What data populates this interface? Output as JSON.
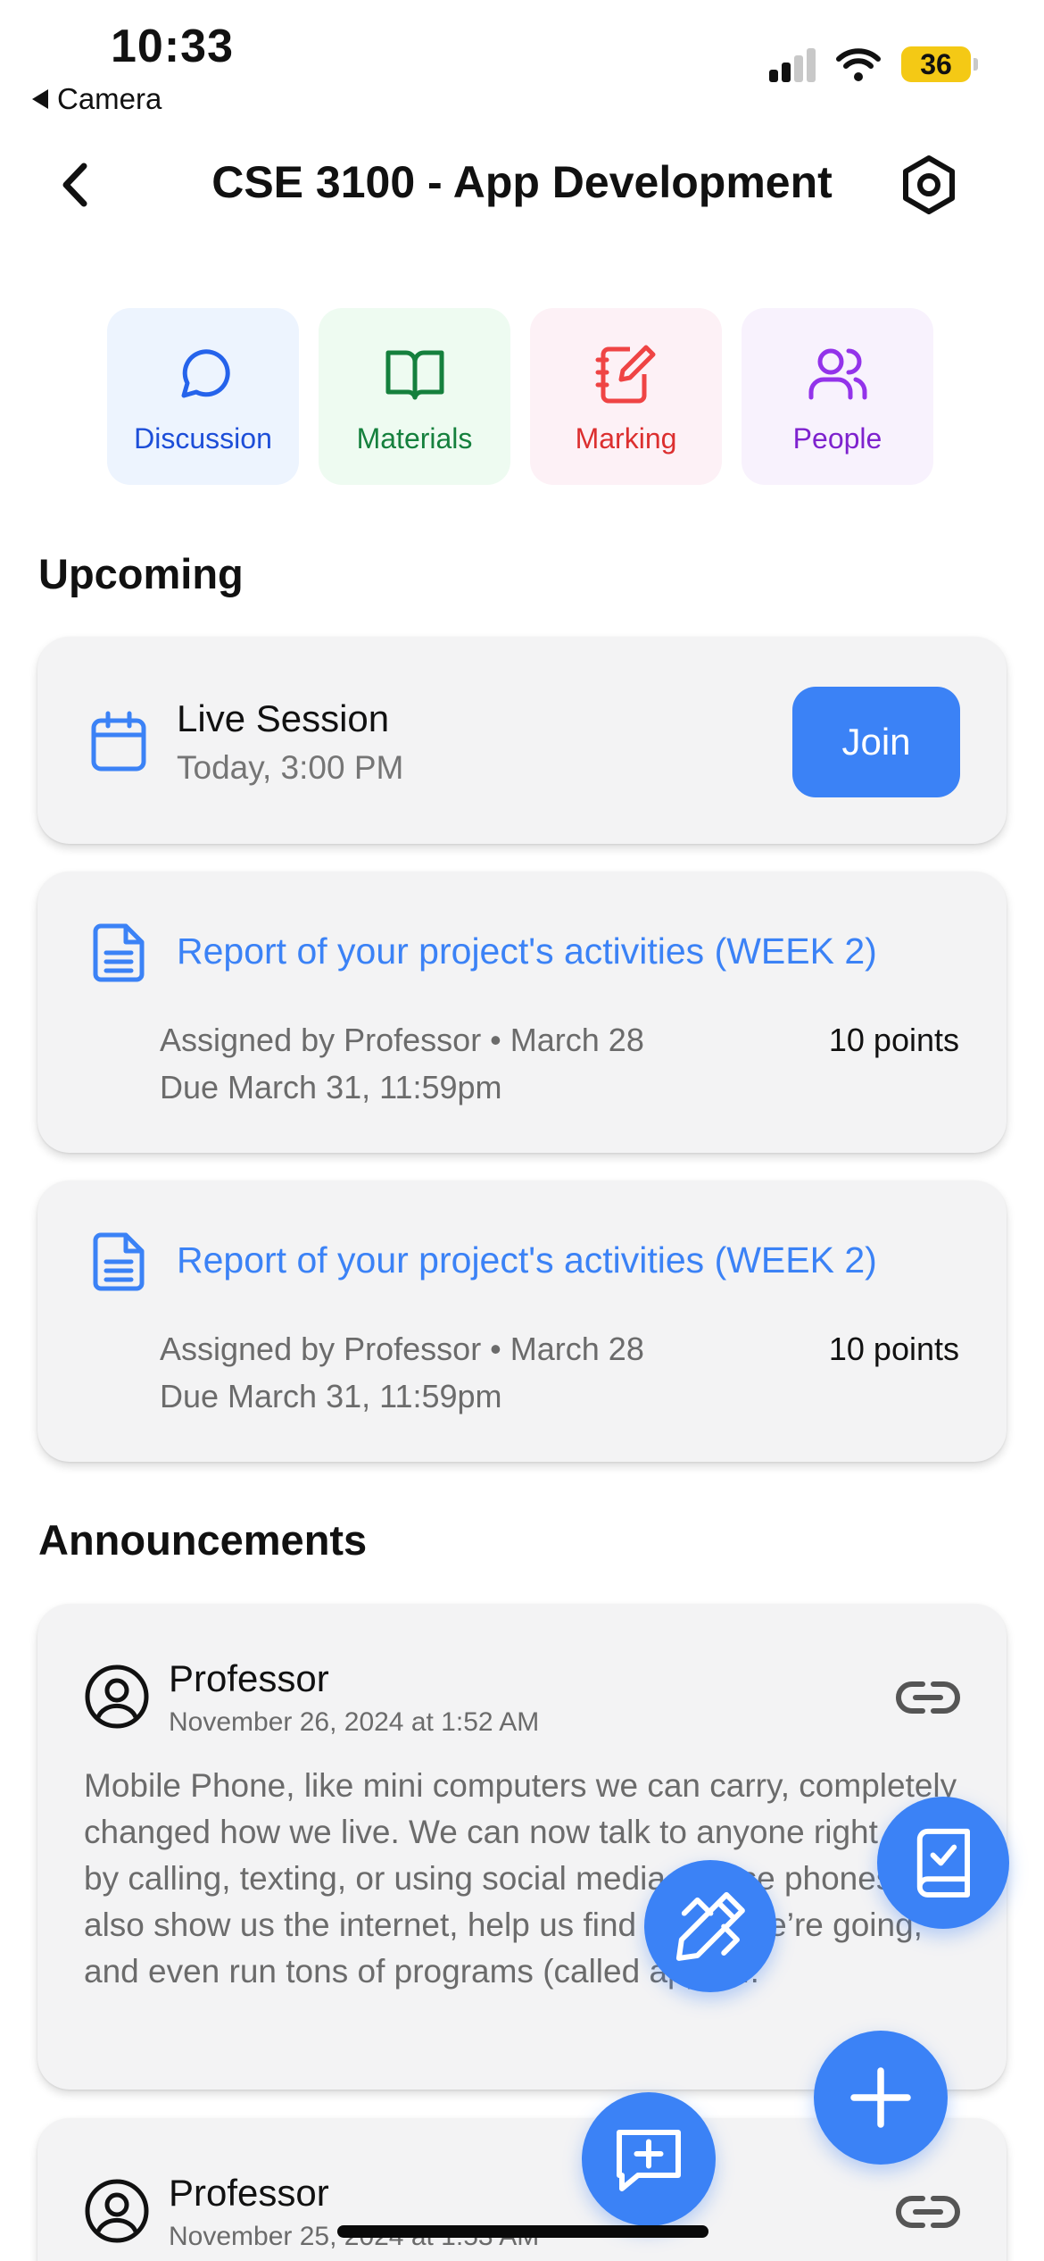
{
  "status_bar": {
    "time": "10:33",
    "back_app": "Camera",
    "battery": "36",
    "signal_icon": "cellular-signal-icon",
    "wifi_icon": "wifi-icon"
  },
  "header": {
    "title": "CSE 3100 - App Development",
    "back_icon": "chevron-left-icon",
    "settings_icon": "settings-hexagon-icon"
  },
  "tiles": [
    {
      "label": "Discussion",
      "icon": "chat-bubble-icon",
      "color": "#1d4ed8",
      "bg": "#edf4fe"
    },
    {
      "label": "Materials",
      "icon": "open-book-icon",
      "color": "#15803d",
      "bg": "#eefbf1"
    },
    {
      "label": "Marking",
      "icon": "notebook-pen-icon",
      "color": "#dc2f2f",
      "bg": "#fdf1f6"
    },
    {
      "label": "People",
      "icon": "users-icon",
      "color": "#7e22ce",
      "bg": "#f8f2fd"
    }
  ],
  "upcoming": {
    "heading": "Upcoming",
    "session": {
      "title": "Live Session",
      "time": "Today, 3:00 PM",
      "join_label": "Join",
      "icon": "calendar-icon"
    },
    "assignments": [
      {
        "title": "Report of your project's activities (WEEK 2)",
        "assigned": "Assigned by Professor • March 28",
        "due": "Due March 31, 11:59pm",
        "points": "10 points",
        "icon": "document-icon"
      },
      {
        "title": "Report of your project's activities (WEEK 2)",
        "assigned": "Assigned by Professor • March 28",
        "due": "Due March 31, 11:59pm",
        "points": "10 points",
        "icon": "document-icon"
      }
    ]
  },
  "announcements": {
    "heading": "Announcements",
    "items": [
      {
        "author": "Professor",
        "posted": "November 26, 2024 at 1:52 AM",
        "body": "Mobile Phone, like mini computers we can carry, completely changed how we live. We can now talk to anyone right away by calling, texting, or using social media. These phones can also show us the internet, help us find where we’re going, and even run tons of programs (called apps)...",
        "icon": "user-circle-icon",
        "link_icon": "link-icon"
      },
      {
        "author": "Professor",
        "posted": "November 25, 2024 at 1:53 AM",
        "icon": "user-circle-icon",
        "link_icon": "link-icon"
      }
    ]
  },
  "fabs": [
    {
      "name": "assignment-fab",
      "icon": "book-check-icon"
    },
    {
      "name": "edit-tools-fab",
      "icon": "pencil-ruler-icon"
    },
    {
      "name": "add-fab",
      "icon": "plus-icon"
    },
    {
      "name": "new-message-fab",
      "icon": "message-plus-icon"
    }
  ],
  "colors": {
    "accent": "#3b82f6",
    "card_bg": "#f3f3f4",
    "muted_text": "#6b6b6b"
  }
}
